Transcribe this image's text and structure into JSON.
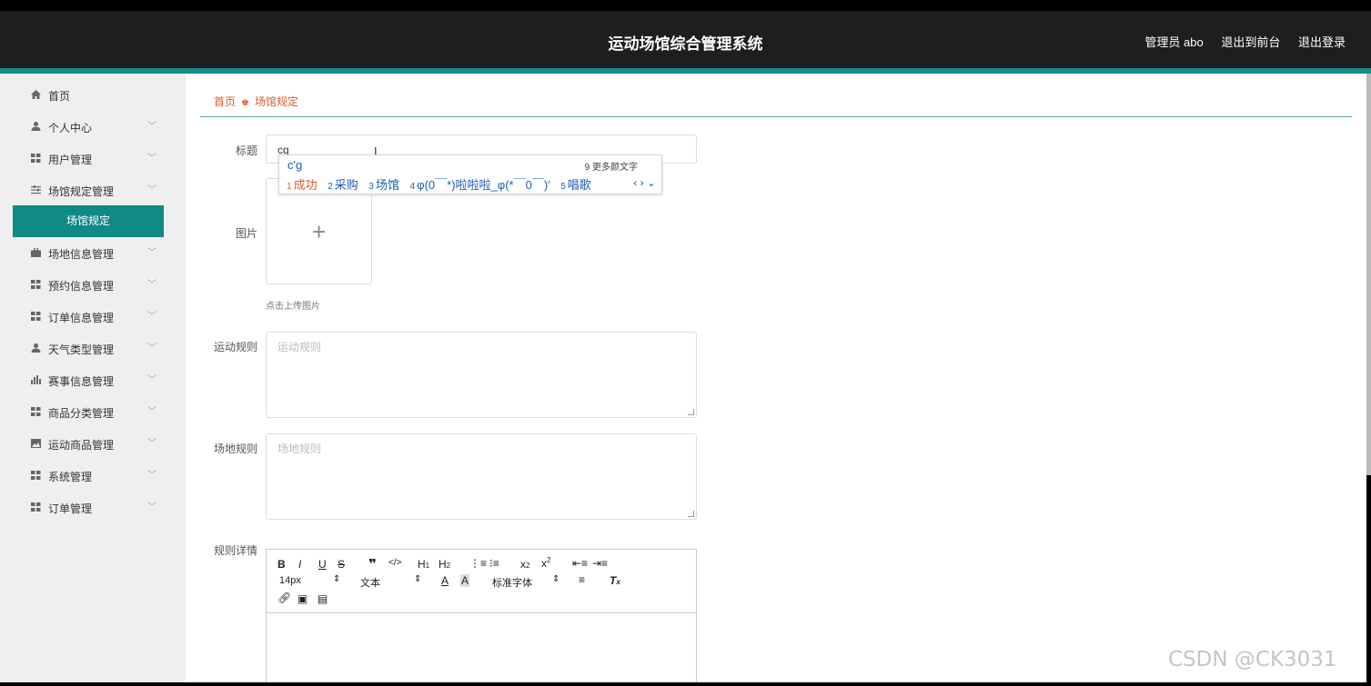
{
  "header": {
    "title": "运动场馆综合管理系统",
    "links": [
      "管理员 abo",
      "退出到前台",
      "退出登录"
    ]
  },
  "sidebar": {
    "items": [
      {
        "label": "首页",
        "icon": "home-icon",
        "chevron": false
      },
      {
        "label": "个人中心",
        "icon": "person-icon",
        "chevron": true
      },
      {
        "label": "用户管理",
        "icon": "grid-icon",
        "chevron": true
      },
      {
        "label": "场馆规定管理",
        "icon": "sliders-icon",
        "chevron": true
      },
      {
        "label": "场地信息管理",
        "icon": "briefcase-icon",
        "chevron": true
      },
      {
        "label": "预约信息管理",
        "icon": "grid-icon",
        "chevron": true
      },
      {
        "label": "订单信息管理",
        "icon": "grid-icon",
        "chevron": true
      },
      {
        "label": "天气类型管理",
        "icon": "person-icon",
        "chevron": true
      },
      {
        "label": "赛事信息管理",
        "icon": "bar-chart-icon",
        "chevron": true
      },
      {
        "label": "商品分类管理",
        "icon": "grid-icon",
        "chevron": true
      },
      {
        "label": "运动商品管理",
        "icon": "picture-icon",
        "chevron": true
      },
      {
        "label": "系统管理",
        "icon": "grid-icon",
        "chevron": true
      },
      {
        "label": "订单管理",
        "icon": "grid-icon",
        "chevron": true
      }
    ],
    "active_sub": "场馆规定"
  },
  "breadcrumb": {
    "home": "首页",
    "current": "场馆规定"
  },
  "form": {
    "title_label": "标题",
    "title_value": "cg",
    "image_label": "图片",
    "upload_hint": "点击上传图片",
    "sport_rules_label": "运动规则",
    "sport_rules_placeholder": "运动规则",
    "venue_rules_label": "场地规则",
    "venue_rules_placeholder": "场地规则",
    "details_label": "规则详情"
  },
  "ime": {
    "composition": "c'g",
    "more": "9 更多颜文字",
    "candidates": [
      {
        "n": "1",
        "text": "成功"
      },
      {
        "n": "2",
        "text": "采购"
      },
      {
        "n": "3",
        "text": "场馆"
      },
      {
        "n": "4",
        "text": "φ(0￣*)啦啦啦_φ(*￣0￣)′"
      },
      {
        "n": "5",
        "text": "唱歌"
      }
    ]
  },
  "editor_toolbar": {
    "font_size": "14px",
    "paragraph": "文本",
    "font_family": "标准字体"
  },
  "watermark": "CSDN @CK3031",
  "colors": {
    "accent": "#0f8a87",
    "breadcrumb": "#e05a2a",
    "header": "#1e1e1e"
  }
}
